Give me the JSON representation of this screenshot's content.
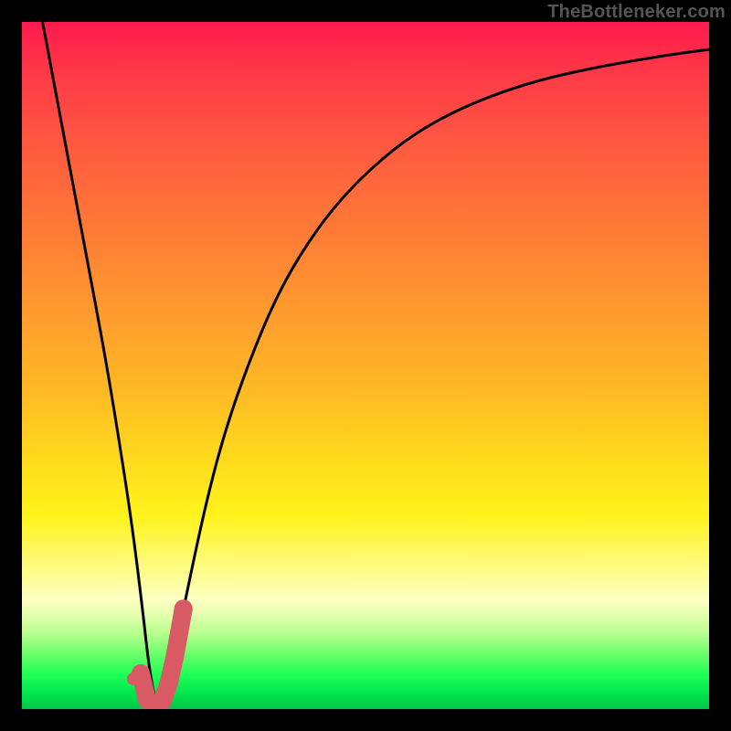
{
  "watermark": "TheBottleneker.com",
  "chart_data": {
    "type": "line",
    "title": "",
    "xlabel": "",
    "ylabel": "",
    "xlim": [
      0,
      100
    ],
    "ylim": [
      0,
      100
    ],
    "series": [
      {
        "name": "curve",
        "x": [
          3,
          6,
          9,
          12,
          14,
          16,
          17.5,
          18.5,
          19.5,
          20.5,
          22,
          24,
          27,
          30,
          34,
          38,
          43,
          48,
          54,
          60,
          67,
          75,
          84,
          94,
          100
        ],
        "y": [
          100,
          84,
          68,
          52,
          40,
          27,
          15,
          6,
          0.6,
          0.8,
          7,
          17,
          31,
          42,
          53,
          62,
          70,
          76,
          81.5,
          85.5,
          88.8,
          91.5,
          93.5,
          95.2,
          96
        ]
      }
    ],
    "markers": {
      "name": "highlight-segment",
      "color": "#d85a64",
      "points": [
        {
          "x": 17.3,
          "y": 5.2
        },
        {
          "x": 18.2,
          "y": 1.4
        },
        {
          "x": 18.9,
          "y": 0.6
        },
        {
          "x": 19.7,
          "y": 0.7
        },
        {
          "x": 20.5,
          "y": 1.2
        },
        {
          "x": 21.4,
          "y": 3.9
        },
        {
          "x": 22.2,
          "y": 7.4
        },
        {
          "x": 22.9,
          "y": 11.2
        },
        {
          "x": 23.5,
          "y": 14.6
        }
      ],
      "isolated_point": {
        "x": 16.2,
        "y": 4.4
      }
    }
  }
}
